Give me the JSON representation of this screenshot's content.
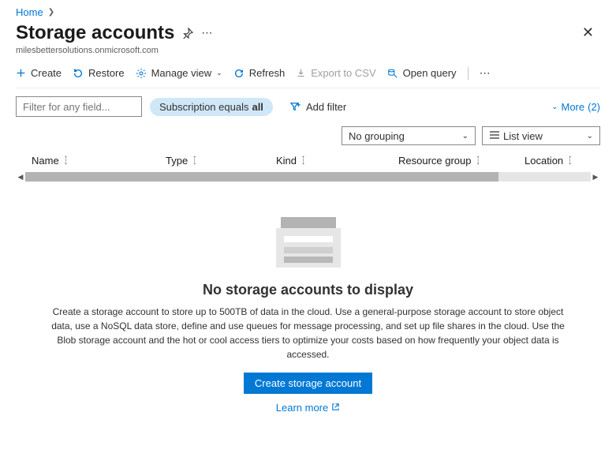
{
  "breadcrumb": {
    "home": "Home"
  },
  "header": {
    "title": "Storage accounts",
    "tenant": "milesbettersolutions.onmicrosoft.com"
  },
  "toolbar": {
    "create": "Create",
    "restore": "Restore",
    "manage_view": "Manage view",
    "refresh": "Refresh",
    "export_csv": "Export to CSV",
    "open_query": "Open query"
  },
  "filters": {
    "placeholder": "Filter for any field...",
    "subscription_pill_prefix": "Subscription equals ",
    "subscription_pill_value": "all",
    "add_filter": "Add filter",
    "more_label": "More ",
    "more_count": "(2)"
  },
  "view": {
    "grouping": "No grouping",
    "list_view": "List view"
  },
  "columns": {
    "name": "Name",
    "type": "Type",
    "kind": "Kind",
    "resource_group": "Resource group",
    "location": "Location"
  },
  "empty": {
    "heading": "No storage accounts to display",
    "body": "Create a storage account to store up to 500TB of data in the cloud. Use a general-purpose storage account to store object data, use a NoSQL data store, define and use queues for message processing, and set up file shares in the cloud. Use the Blob storage account and the hot or cool access tiers to optimize your costs based on how frequently your object data is accessed.",
    "cta": "Create storage account",
    "learn": "Learn more"
  }
}
